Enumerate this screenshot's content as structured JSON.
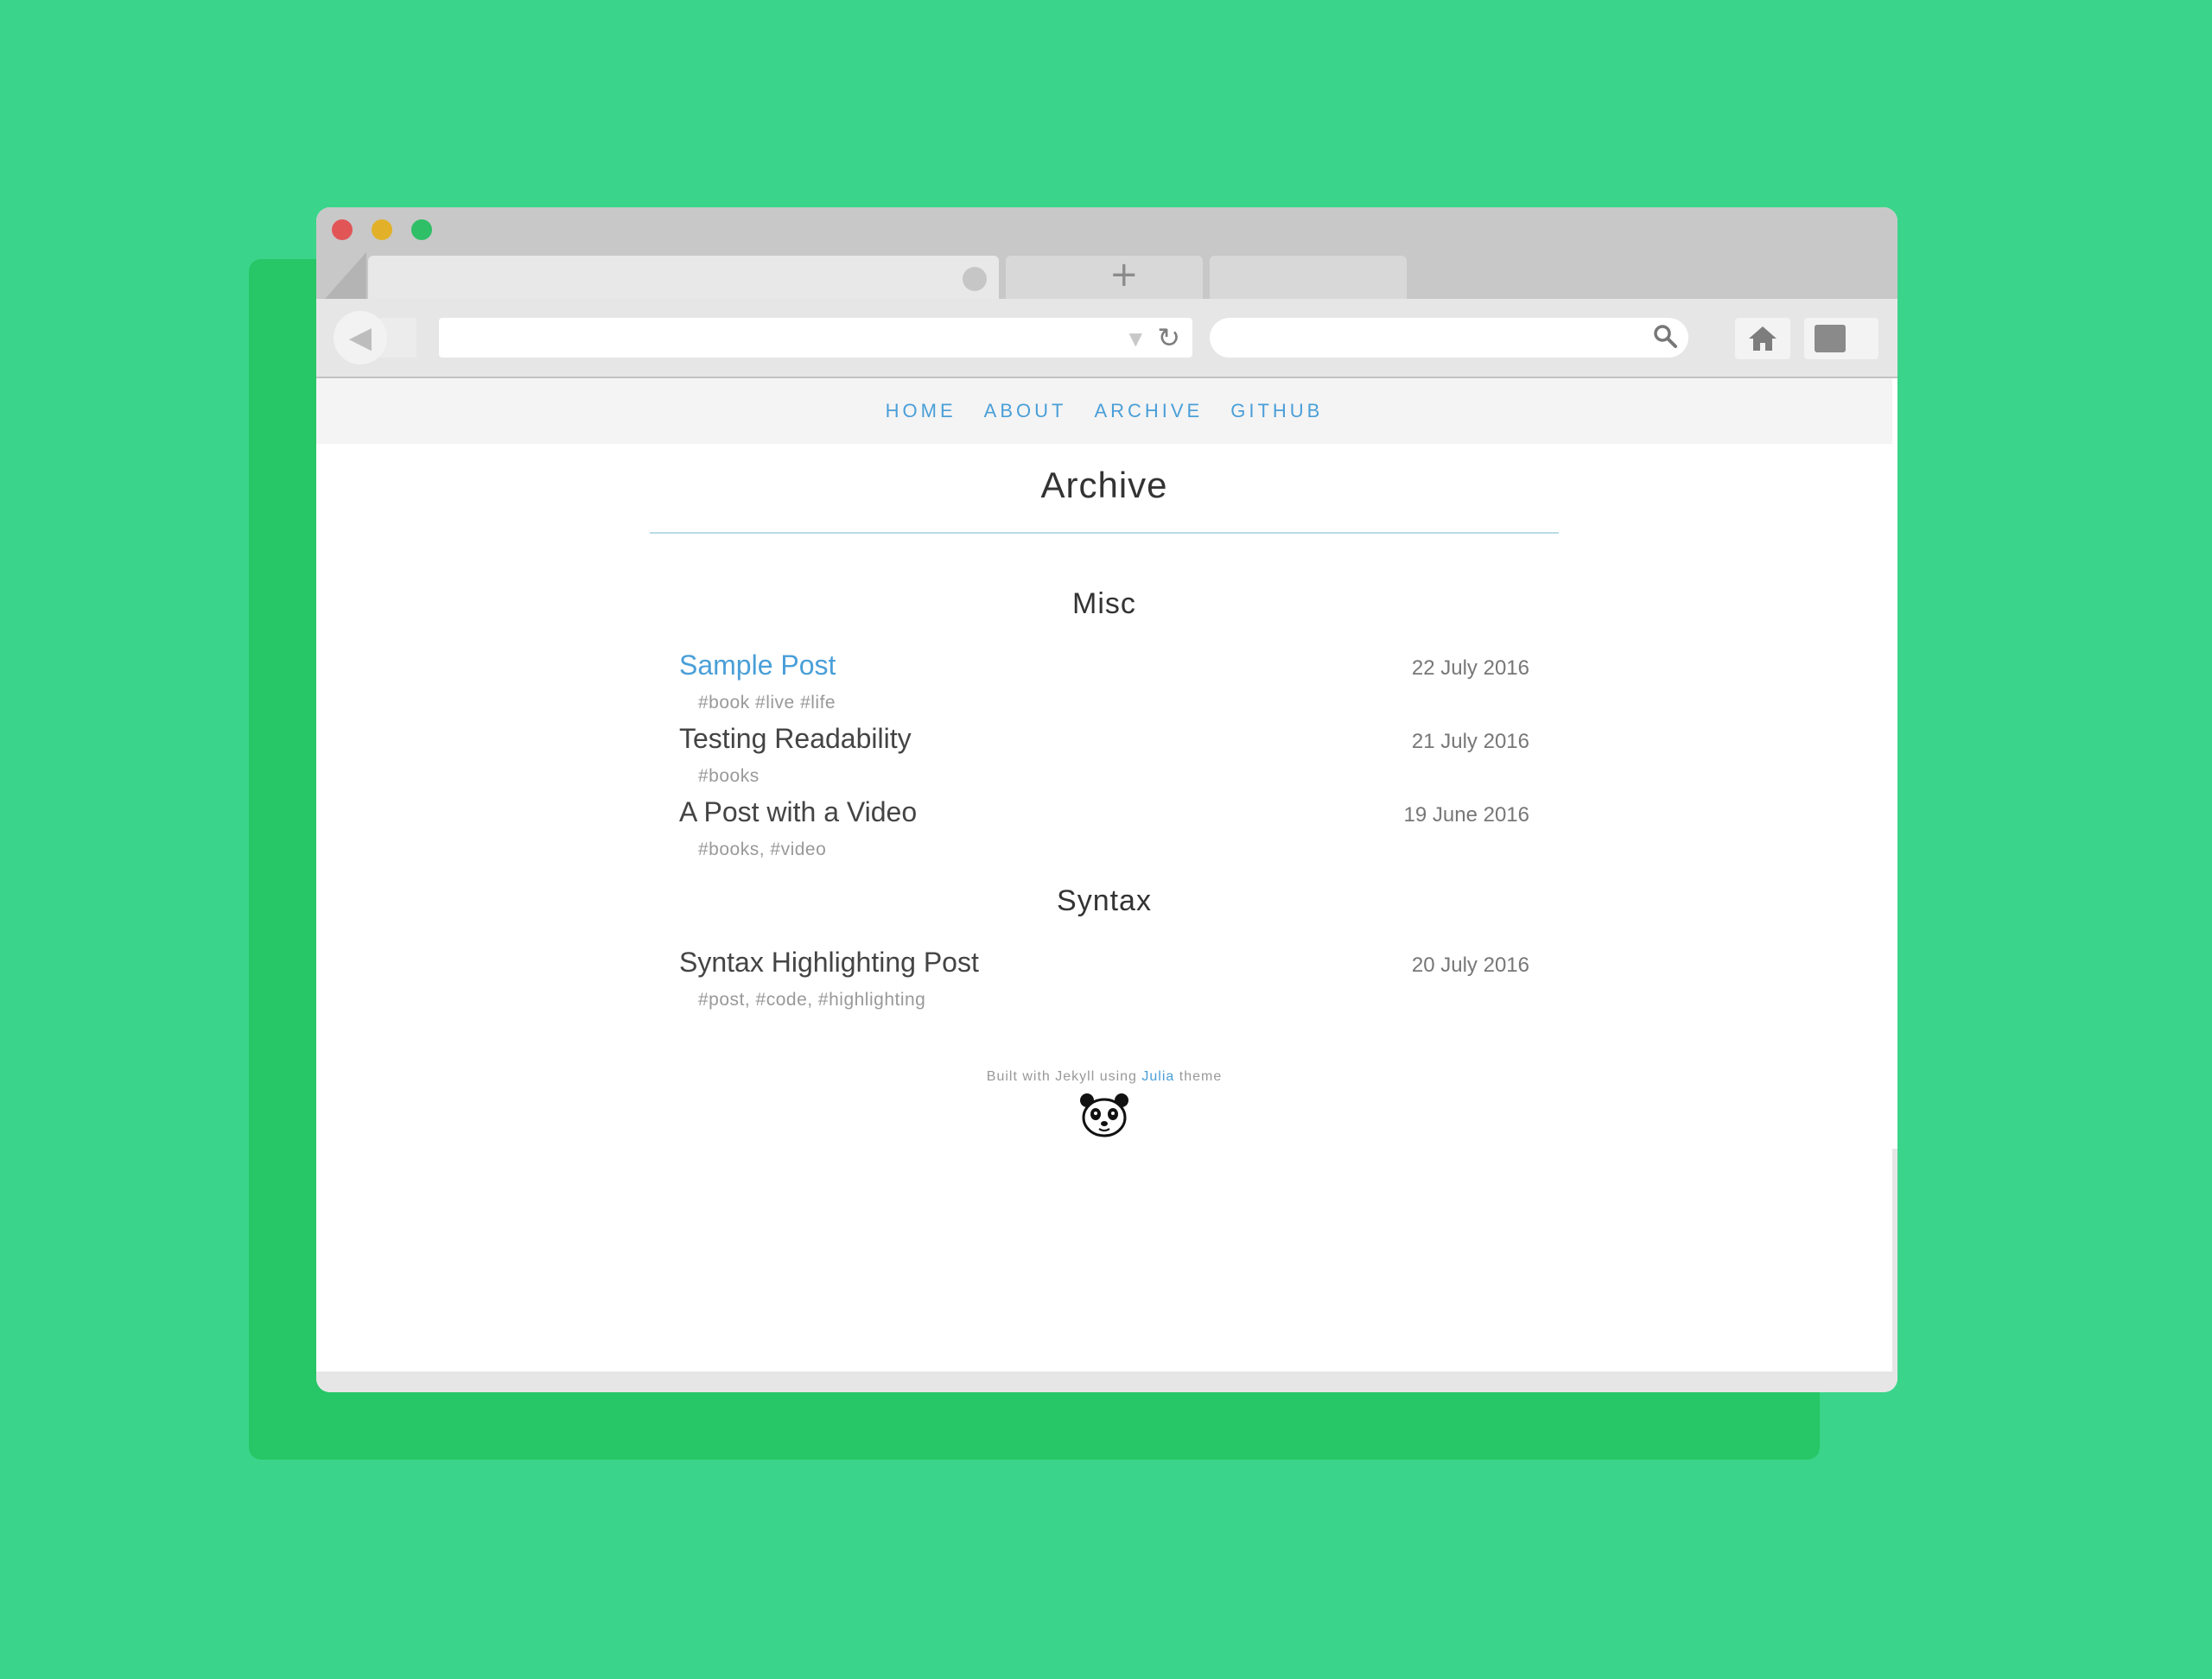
{
  "nav": {
    "items": [
      "HOME",
      "ABOUT",
      "ARCHIVE",
      "GITHUB"
    ]
  },
  "page": {
    "title": "Archive"
  },
  "sections": [
    {
      "name": "Misc",
      "posts": [
        {
          "title": "Sample Post",
          "date": "22 July 2016",
          "tags": "#book #live #life"
        },
        {
          "title": "Testing Readability",
          "date": "21 July 2016",
          "tags": "#books"
        },
        {
          "title": "A Post with a Video",
          "date": "19 June 2016",
          "tags": "#books, #video"
        }
      ]
    },
    {
      "name": "Syntax",
      "posts": [
        {
          "title": "Syntax Highlighting Post",
          "date": "20 July 2016",
          "tags": "#post, #code, #highlighting"
        }
      ]
    }
  ],
  "footer": {
    "prefix": "Built with Jekyll using",
    "link": "Julia",
    "suffix": "theme"
  },
  "browser": {
    "plus": "+",
    "back_icon": "◀",
    "reload_icon": "↻",
    "dropdown_icon": "▼",
    "search_icon": "⚲",
    "home_icon": "⌂"
  },
  "colors": {
    "background": "#3ad58a",
    "shadow": "#27c666",
    "link": "#4a9fd8"
  }
}
